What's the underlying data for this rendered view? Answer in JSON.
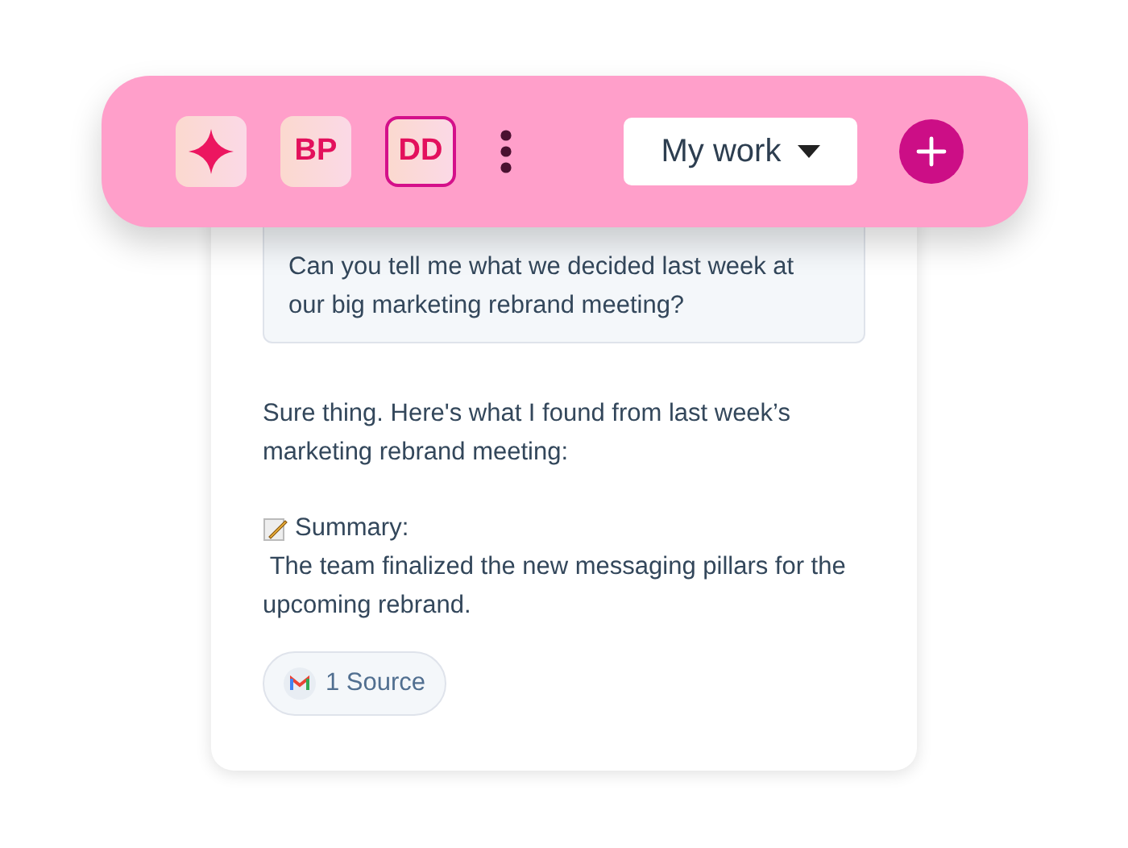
{
  "toolbar": {
    "avatars": [
      {
        "initials": "BP",
        "selected": false
      },
      {
        "initials": "DD",
        "selected": true
      }
    ],
    "view_menu": {
      "label": "My work"
    }
  },
  "chat": {
    "question": "Can you tell me what we decided last week at our big marketing rebrand meeting?",
    "answer_intro": "Sure thing. Here's what I found from last week’s marketing rebrand meeting:",
    "summary_label": "Summary:",
    "summary_text": " The team finalized the new messaging pillars for the upcoming rebrand.",
    "sources": "1 Source"
  }
}
